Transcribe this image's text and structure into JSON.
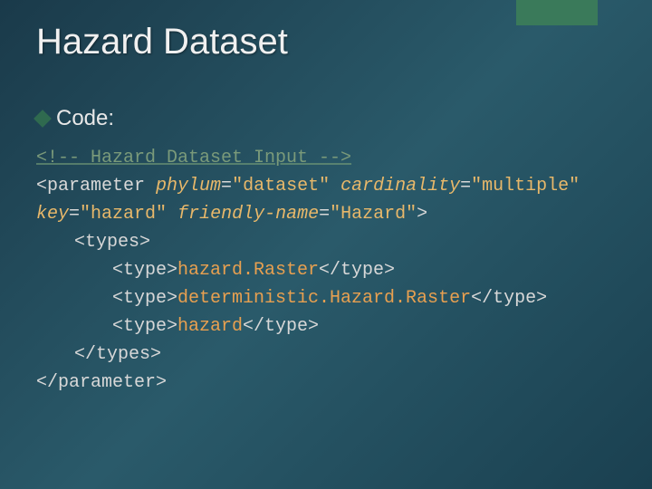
{
  "title": "Hazard Dataset",
  "bullet": {
    "label": "Code:"
  },
  "code": {
    "comment_open": "<!-- ",
    "comment_text": "Hazard Dataset Input -->",
    "param_open_1": "<parameter ",
    "attr_phylum_k": "phylum",
    "eq": "=",
    "attr_phylum_v": "\"dataset\"",
    "attr_card_k": "cardinality",
    "attr_card_v": "\"multiple\"",
    "attr_key_k": "key",
    "attr_key_v": "\"hazard\"",
    "attr_fn_k": "friendly-name",
    "attr_fn_v": "\"Hazard\"",
    "param_open_end": ">",
    "types_open": "<types>",
    "type_open": "<type>",
    "type_close": "</type>",
    "type1": "hazard.Raster",
    "type2": "deterministic.Hazard.Raster",
    "type3": "hazard",
    "types_close": "</types>",
    "param_close": "</parameter>"
  }
}
